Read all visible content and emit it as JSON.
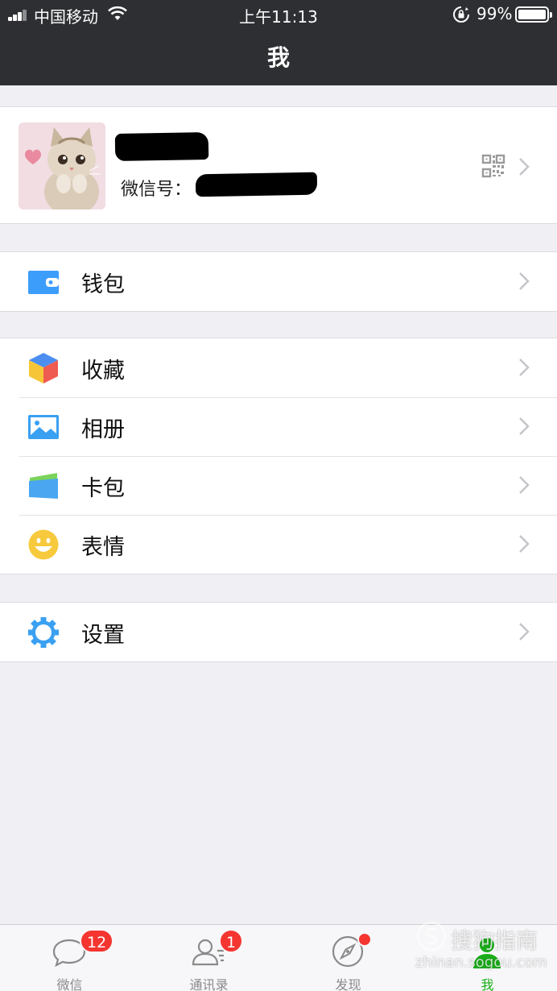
{
  "status_bar": {
    "carrier": "中国移动",
    "time": "上午11:13",
    "battery_percent": "99%",
    "battery_level": 0.99
  },
  "nav": {
    "title": "我"
  },
  "profile": {
    "wechat_id_label": "微信号："
  },
  "groups": [
    [
      {
        "label": "钱包",
        "icon": "wallet-icon"
      }
    ],
    [
      {
        "label": "收藏",
        "icon": "favorites-cube-icon"
      },
      {
        "label": "相册",
        "icon": "album-icon"
      },
      {
        "label": "卡包",
        "icon": "card-pack-icon"
      },
      {
        "label": "表情",
        "icon": "sticker-smile-icon"
      }
    ],
    [
      {
        "label": "设置",
        "icon": "settings-gear-icon"
      }
    ]
  ],
  "tabbar": {
    "tabs": [
      {
        "label": "微信",
        "badge": "12",
        "icon": "chat-bubble-icon"
      },
      {
        "label": "通讯录",
        "badge": "1",
        "icon": "contacts-icon"
      },
      {
        "label": "发现",
        "icon": "discover-compass-icon"
      },
      {
        "label": "我",
        "icon": "me-person-icon",
        "active": true
      }
    ]
  },
  "watermark": {
    "brand": "搜狗指南",
    "url": "zhinan.sogou.com"
  },
  "colors": {
    "nav_bg": "#2e2f33",
    "page_bg": "#efeff4",
    "active_green": "#1aad19",
    "badge_red": "#f43530"
  }
}
